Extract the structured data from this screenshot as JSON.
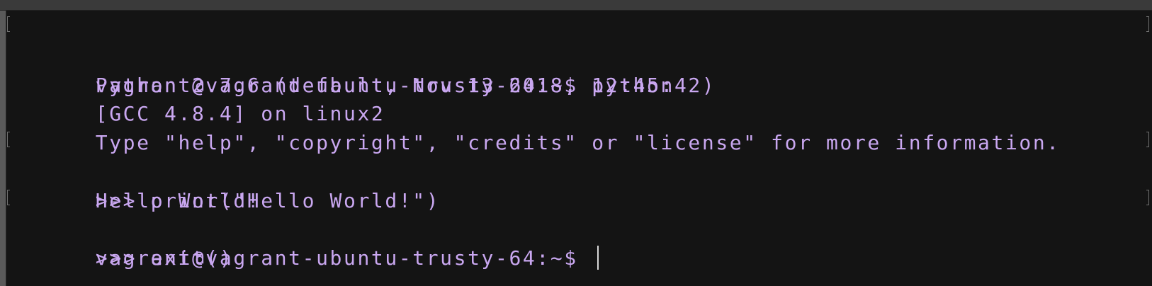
{
  "terminal": {
    "lines": [
      {
        "text": "vagrant@vagrant-ubuntu-trusty-64:~$ python",
        "marked": true
      },
      {
        "text": "Python 2.7.6 (default, Nov 13 2018, 12:45:42)",
        "marked": false
      },
      {
        "text": "[GCC 4.8.4] on linux2",
        "marked": false
      },
      {
        "text": "Type \"help\", \"copyright\", \"credits\" or \"license\" for more information.",
        "marked": false
      },
      {
        "text": ">>> print(\"Hello World!\")",
        "marked": true
      },
      {
        "text": "Hello World!",
        "marked": false
      },
      {
        "text": ">>> exit()",
        "marked": true
      },
      {
        "text": "vagrant@vagrant-ubuntu-trusty-64:~$ ",
        "marked": false
      }
    ]
  },
  "colors": {
    "background": "#141414",
    "text": "#c9a7f0",
    "cursor": "#d8d8d8"
  }
}
